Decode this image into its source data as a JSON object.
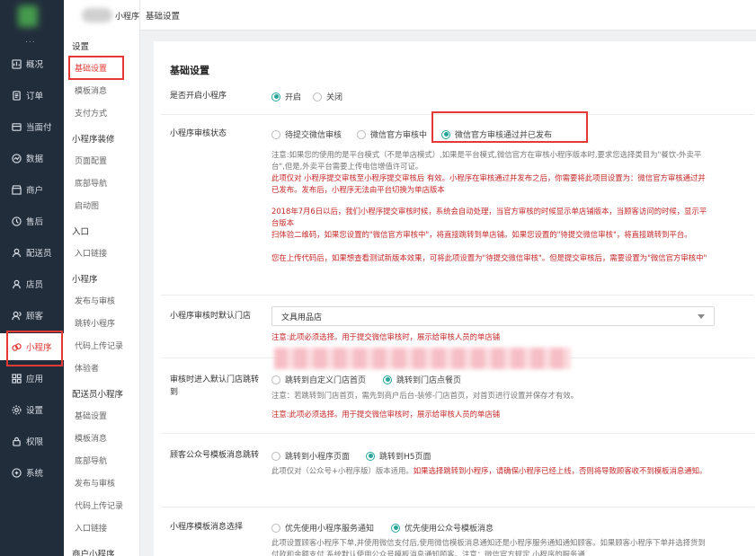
{
  "nav": {
    "items": [
      {
        "label": "概况",
        "icon": "overview-icon"
      },
      {
        "label": "订单",
        "icon": "order-icon"
      },
      {
        "label": "当面付",
        "icon": "pay-icon"
      },
      {
        "label": "数据",
        "icon": "data-icon"
      },
      {
        "label": "商户",
        "icon": "merchant-icon"
      },
      {
        "label": "售后",
        "icon": "aftersale-icon"
      },
      {
        "label": "配送员",
        "icon": "courier-icon"
      },
      {
        "label": "店员",
        "icon": "staff-icon"
      },
      {
        "label": "顾客",
        "icon": "customer-icon"
      },
      {
        "label": "小程序",
        "icon": "miniprogram-icon"
      },
      {
        "label": "应用",
        "icon": "apps-icon"
      },
      {
        "label": "设置",
        "icon": "settings-icon"
      },
      {
        "label": "权限",
        "icon": "lock-icon"
      },
      {
        "label": "系统",
        "icon": "system-icon"
      }
    ],
    "dots": "..."
  },
  "sub": {
    "shop_suffix": "小程序",
    "groups": [
      {
        "title": "设置",
        "items": [
          "基础设置",
          "模板消息",
          "支付方式"
        ]
      },
      {
        "title": "小程序装修",
        "items": [
          "页面配置",
          "底部导航",
          "启动图"
        ]
      },
      {
        "title": "入口",
        "items": [
          "入口链接"
        ]
      },
      {
        "title": "小程序",
        "items": [
          "发布与审核",
          "跳转小程序",
          "代码上传记录",
          "体验者"
        ]
      },
      {
        "title": "配送员小程序",
        "items": [
          "基础设置",
          "模板消息",
          "底部导航",
          "发布与审核",
          "代码上传记录",
          "入口链接"
        ]
      },
      {
        "title": "商户小程序",
        "items": []
      }
    ]
  },
  "breadcrumb": "基础设置",
  "main": {
    "section_title": "基础设置",
    "open": {
      "label": "是否开启小程序",
      "on": "开启",
      "off": "关闭"
    },
    "audit": {
      "label": "小程序审核状态",
      "opt1": "待提交微信审核",
      "opt2": "微信官方审核中",
      "opt3": "微信官方审核通过并已发布",
      "note1": "注意:如果您的使用的是平台模式（不是单店模式）,如果是平台模式,微信官方在审核小程序版本时,要求您选择类目为\"餐饮-外卖平台\",但是,外卖平台需要上传电信增值许可证。",
      "note2": "此项仅对 小程序提交审核至小程序提交审核后 有效。小程序在审核通过并发布之后，你需要将此项目设置为：微信官方审核通过并已发布。发布后，小程序无法由平台切换为单店版本",
      "note3": "2018年7月6日以后，我们小程序提交审核时候，系统会自动处理，当官方审核的时候显示单店铺版本，当顾客访问的时候，显示平台版本",
      "note4": "扫体验二维码，如果您设置的\"微信官方审核中\"，将直接跳转到单店铺。如果您设置的\"待提交微信审核\"，将直接跳转到平台。",
      "note5": "您在上传代码后，如果想查看测试新版本效果，可将此项设置为\"待提交微信审核\"。但是提交审核后，需要设置为\"微信官方审核中\""
    },
    "default_store": {
      "label": "小程序审核时默认门店",
      "value": "文具用品店",
      "note": "注意:此项必须选择。用于提交微信审核时，展示给审核人员的单店铺"
    },
    "jump": {
      "label": "审核时进入默认门店跳转到",
      "opt1": "跳转到自定义门店首页",
      "opt2": "跳转到门店点餐页",
      "note1": "注意：若跳转到门店首页，需先到商户后台-装修-门店首页，对首页进行设置并保存才有效。",
      "note2": "注意:此项必须选择。用于提交微信审核时，展示给审核人员的单店铺"
    },
    "customer_msg": {
      "label": "顾客公众号模板消息跳转",
      "opt1": "跳转到小程序页面",
      "opt2": "跳转到H5页面",
      "note_grey": "此项仅对（公众号+小程序版）版本适用。",
      "note_red": "如果选择跳转到小程序，请确保小程序已经上线，否则将导致顾客收不到模板消息通知。"
    },
    "msg_choice": {
      "label": "小程序模板消息选择",
      "opt1": "优先使用小程序服务通知",
      "opt2": "优先使用公众号模板消息",
      "note": "此项设置顾客小程序下单,并使用微信支付后,使用微信模板消息通知还是小程序服务通知通知顾客。如果顾客小程序下单并选择货到付款和余额支付,系统默认使用公众号模板消息通知顾客。注意：微信官方规定,小程序的服务通"
    }
  }
}
